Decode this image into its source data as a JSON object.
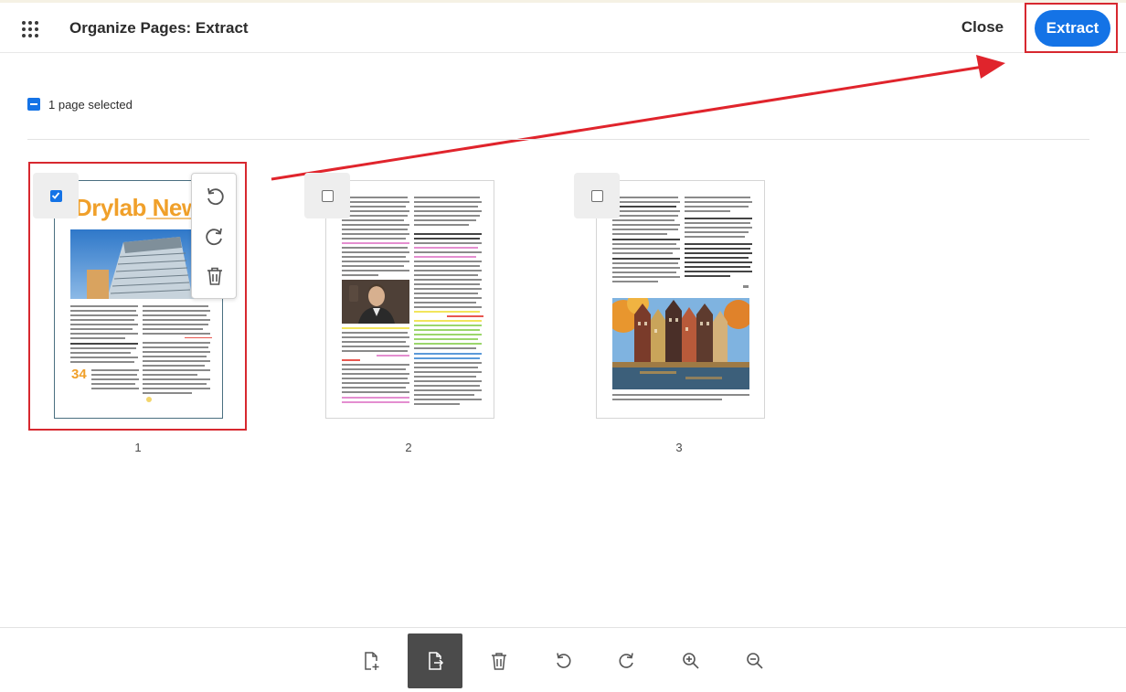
{
  "header": {
    "title": "Organize Pages: Extract",
    "close_label": "Close",
    "extract_label": "Extract"
  },
  "selection": {
    "status_text": "1 page selected"
  },
  "pages": [
    {
      "number": "1",
      "selected": true,
      "masthead": "Drylab News",
      "stat": "34"
    },
    {
      "number": "2",
      "selected": false
    },
    {
      "number": "3",
      "selected": false
    }
  ],
  "thumbnail_menu": {
    "icons": [
      "rotate-left-icon",
      "rotate-right-icon",
      "trash-icon"
    ]
  },
  "toolbar": {
    "tools": [
      "insert-page-icon",
      "extract-page-icon",
      "trash-icon",
      "rotate-left-icon",
      "rotate-right-icon",
      "zoom-in-icon",
      "zoom-out-icon"
    ],
    "active_tool": "extract-page-icon"
  },
  "colors": {
    "accent": "#1473e6",
    "annotation_red": "#d7282f",
    "active_tool": "#4b4b4b"
  }
}
